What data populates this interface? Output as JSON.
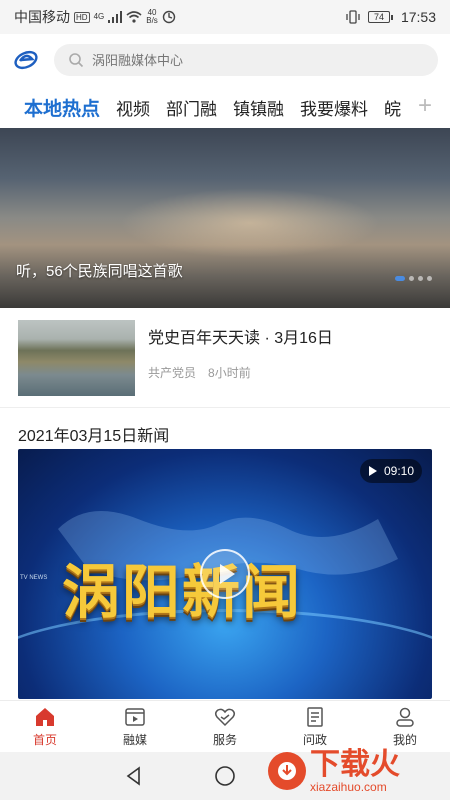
{
  "status_bar": {
    "carrier": "中国移动",
    "hd_badge": "HD",
    "network": "4G",
    "speed_value": "40",
    "speed_unit": "B/s",
    "battery": "74",
    "time": "17:53"
  },
  "header": {
    "search_placeholder": "涡阳融媒体中心"
  },
  "tabs": [
    {
      "label": "本地热点"
    },
    {
      "label": "视频"
    },
    {
      "label": "部门融"
    },
    {
      "label": "镇镇融"
    },
    {
      "label": "我要爆料"
    },
    {
      "label": "皖"
    }
  ],
  "banner": {
    "title": "听，56个民族同唱这首歌",
    "slide_count": 4,
    "active_slide": 1
  },
  "news_item": {
    "title": "党史百年天天读 · 3月16日",
    "source": "共产党员",
    "time": "8小时前"
  },
  "section": {
    "title": "2021年03月15日新闻"
  },
  "video": {
    "title": "涡阳新闻",
    "duration": "09:10",
    "ticker": "TV NEWS"
  },
  "bottom_nav": [
    {
      "label": "首页",
      "icon": "home-icon",
      "active": true
    },
    {
      "label": "融媒",
      "icon": "media-icon",
      "active": false
    },
    {
      "label": "服务",
      "icon": "service-icon",
      "active": false
    },
    {
      "label": "问政",
      "icon": "politics-icon",
      "active": false
    },
    {
      "label": "我的",
      "icon": "profile-icon",
      "active": false
    }
  ],
  "watermark": {
    "name": "下载火",
    "domain": "xiazaihuo.com"
  },
  "colors": {
    "accent": "#1e6fd0",
    "nav_active": "#d83a2e",
    "watermark": "#e44b2b"
  }
}
